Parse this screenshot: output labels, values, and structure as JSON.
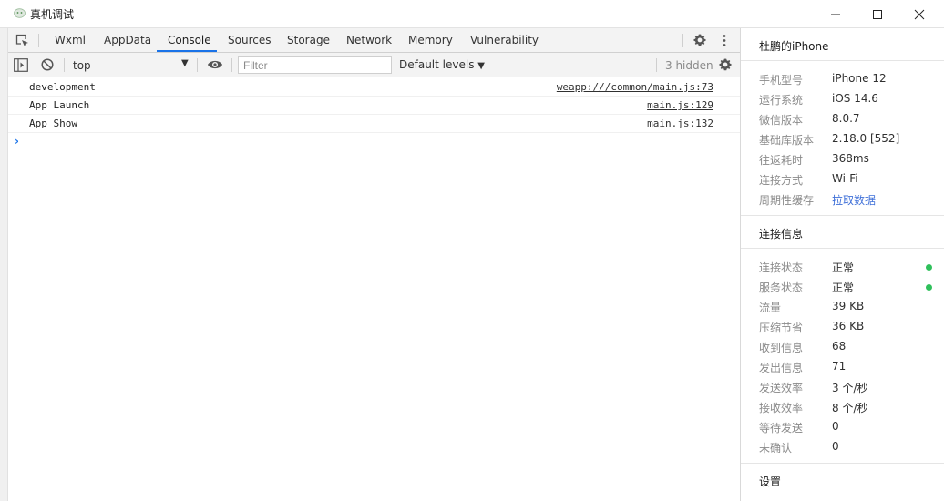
{
  "window": {
    "title": "真机调试"
  },
  "tabs": [
    {
      "label": "Wxml"
    },
    {
      "label": "AppData"
    },
    {
      "label": "Console"
    },
    {
      "label": "Sources"
    },
    {
      "label": "Storage"
    },
    {
      "label": "Network"
    },
    {
      "label": "Memory"
    },
    {
      "label": "Vulnerability"
    }
  ],
  "console_toolbar": {
    "context": "top",
    "filter_placeholder": "Filter",
    "levels": "Default levels",
    "hidden": "3 hidden"
  },
  "console_rows": [
    {
      "message": "development",
      "source": "weapp:///common/main.js:73"
    },
    {
      "message": "App Launch",
      "source": "main.js:129"
    },
    {
      "message": "App Show",
      "source": "main.js:132"
    }
  ],
  "prompt": "›",
  "device": {
    "title": "杜鹏的iPhone",
    "rows": [
      {
        "key": "手机型号",
        "value": "iPhone 12"
      },
      {
        "key": "运行系统",
        "value": "iOS 14.6"
      },
      {
        "key": "微信版本",
        "value": "8.0.7"
      },
      {
        "key": "基础库版本",
        "value": "2.18.0 [552]"
      },
      {
        "key": "往返耗时",
        "value": "368ms"
      },
      {
        "key": "连接方式",
        "value": "Wi-Fi"
      },
      {
        "key": "周期性缓存",
        "value": "拉取数据"
      }
    ]
  },
  "connection": {
    "title": "连接信息",
    "rows": [
      {
        "key": "连接状态",
        "value": "正常"
      },
      {
        "key": "服务状态",
        "value": "正常"
      },
      {
        "key": "流量",
        "value": "39 KB"
      },
      {
        "key": "压缩节省",
        "value": "36 KB"
      },
      {
        "key": "收到信息",
        "value": "68"
      },
      {
        "key": "发出信息",
        "value": "71"
      },
      {
        "key": "发送效率",
        "value": "3 个/秒"
      },
      {
        "key": "接收效率",
        "value": "8 个/秒"
      },
      {
        "key": "等待发送",
        "value": "0"
      },
      {
        "key": "未确认",
        "value": "0"
      }
    ]
  },
  "settings": {
    "title": "设置"
  },
  "colors": {
    "accent": "#1a73e8",
    "status_ok": "#2fc05b",
    "link": "#3e6fd8"
  }
}
